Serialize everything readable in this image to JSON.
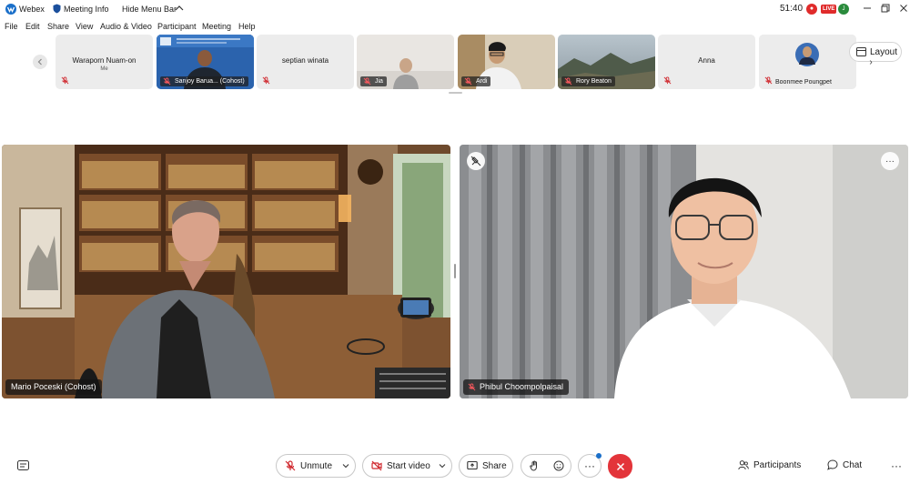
{
  "titlebar": {
    "app_name": "Webex",
    "meeting_info": "Meeting Info",
    "hide_menu_bar": "Hide Menu Bar",
    "timer": "51:40",
    "live_badge": "LIVE",
    "user_initial": "J"
  },
  "menu": [
    {
      "label": "File"
    },
    {
      "label": "Edit"
    },
    {
      "label": "Share"
    },
    {
      "label": "View"
    },
    {
      "label": "Audio & Video"
    },
    {
      "label": "Participant"
    },
    {
      "label": "Meeting"
    },
    {
      "label": "Help"
    }
  ],
  "filmstrip": [
    {
      "name": "Waraporn Nuam-on",
      "sub": "Me",
      "type": "blank"
    },
    {
      "name": "Sanjoy Barua... (Cohost)",
      "type": "video"
    },
    {
      "name": "septian winata",
      "type": "blank"
    },
    {
      "name": "Jia",
      "type": "video"
    },
    {
      "name": "Ardi",
      "type": "video"
    },
    {
      "name": "Rory Beaton",
      "type": "video"
    },
    {
      "name": "Anna",
      "type": "blank"
    },
    {
      "name": "Boonmee Poungpet",
      "type": "avatar"
    }
  ],
  "layout_label": "Layout",
  "main_videos": {
    "left_name": "Mario Poceski (Cohost)",
    "right_name": "Phibul Choompolpaisal"
  },
  "controls": {
    "unmute": "Unmute",
    "start_video": "Start video",
    "share": "Share",
    "participants": "Participants",
    "chat": "Chat",
    "more": "···"
  },
  "colors": {
    "end_call": "#e3343a",
    "muted_icon": "#d0282e",
    "accent": "#1a6fc9"
  }
}
